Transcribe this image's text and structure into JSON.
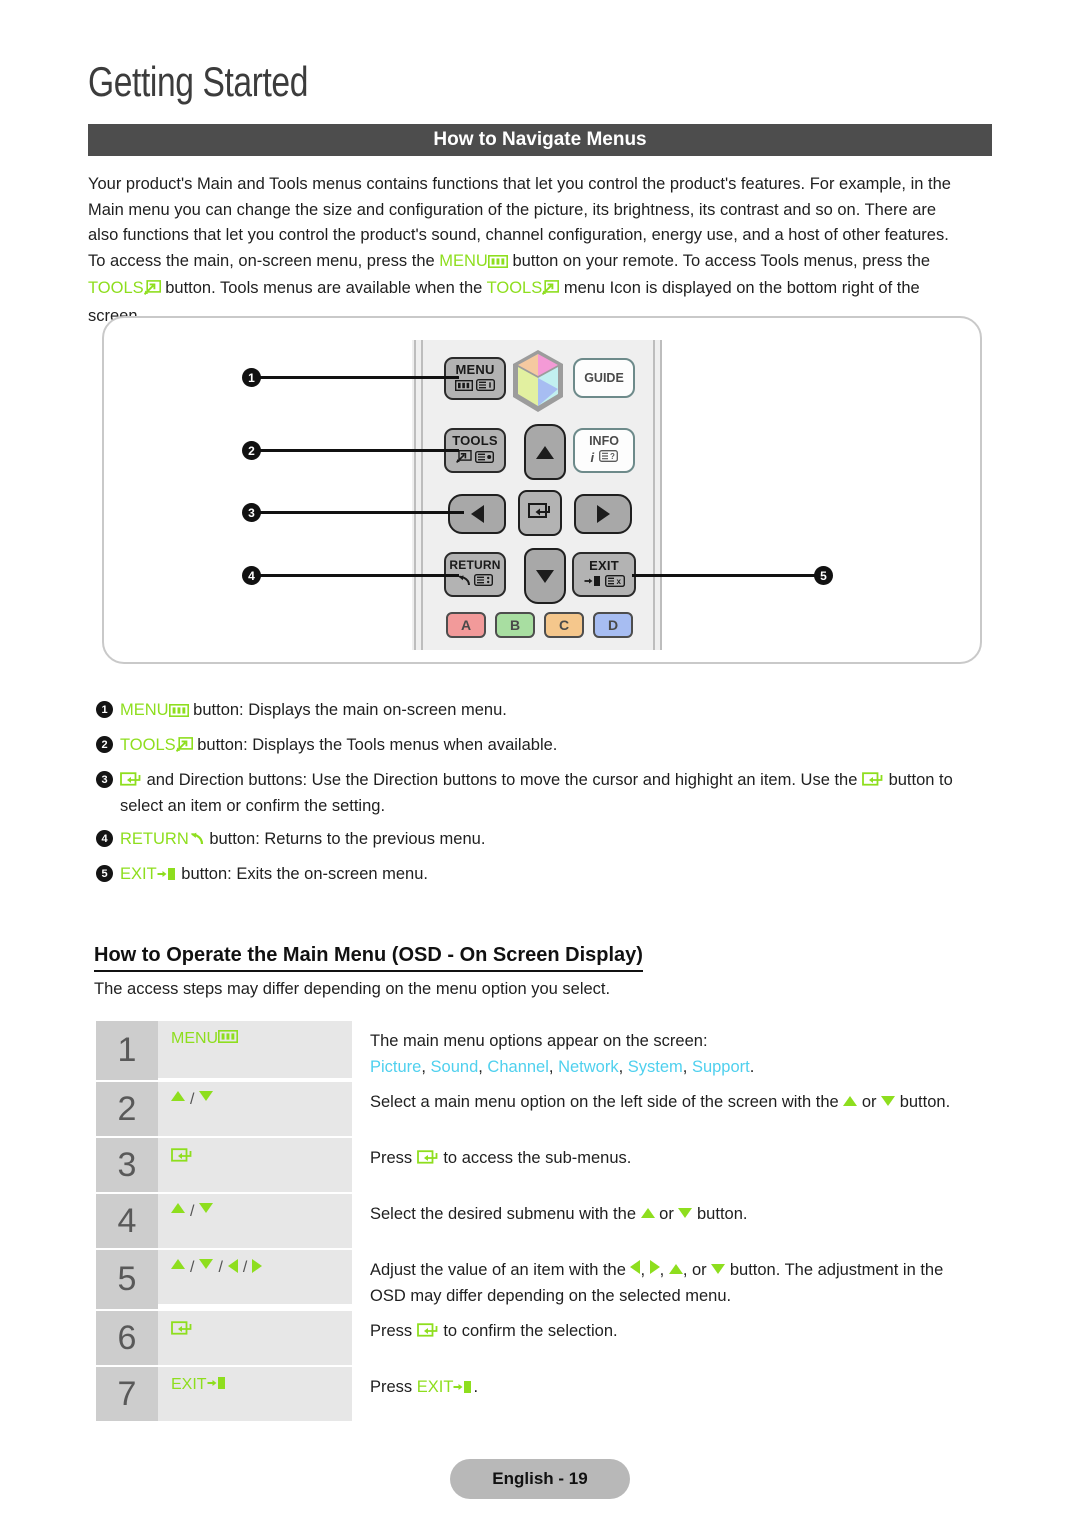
{
  "header": {
    "chapter_title": "Getting Started",
    "section_title": "How to Navigate Menus"
  },
  "intro": {
    "line1_a": "Your product's Main and Tools menus contains functions that let you control the product's features. For example, in the",
    "line2_a": "Main menu you can change the size and configuration of the picture, its brightness, its contrast and so on. There are",
    "line3_a": "also functions that let you control the product's sound, channel configuration, energy use, and a host of other features.",
    "line4_a": "To access the main, on-screen menu, press the ",
    "line4_key": "MENU",
    "line4_b": " button on your remote. To access Tools menus, press the",
    "line5_key": "TOOLS",
    "line5_a": " button. Tools menus are available when the ",
    "line5_key2": "TOOLS",
    "line5_b": " menu Icon is displayed on the bottom right of the",
    "line6": "screen"
  },
  "remote": {
    "buttons": {
      "menu": "MENU",
      "tools": "TOOLS",
      "guide": "GUIDE",
      "info": "INFO",
      "return": "RETURN",
      "exit": "EXIT"
    },
    "color_buttons": [
      {
        "label": "A",
        "color": "#f29a9a"
      },
      {
        "label": "B",
        "color": "#a8dea1"
      },
      {
        "label": "C",
        "color": "#f5c78c"
      },
      {
        "label": "D",
        "color": "#a7bdf2"
      }
    ],
    "cube_colors": {
      "top_left": "#f5c9a0",
      "top_right": "#f49ad6",
      "left": "#e2f0a0",
      "right": "#c2f0f0",
      "bottom_right": "#a9c2f2",
      "edge": "#9c9c9c"
    },
    "callouts": [
      "1",
      "2",
      "3",
      "4",
      "5"
    ]
  },
  "bullets": [
    {
      "num": "1",
      "key": "MENU",
      "icon": "menu-bars-icon",
      "text": " button: Displays the main on-screen menu."
    },
    {
      "num": "2",
      "key": "TOOLS",
      "icon": "tools-arrow-icon",
      "text": " button: Displays the Tools menus when available."
    },
    {
      "num": "3",
      "key": "",
      "icon": "enter-icon",
      "text_a": " and Direction buttons: Use the Direction buttons to move the cursor and highight an item. Use the ",
      "text_b": " button to",
      "text_c": "select an item or confirm the setting."
    },
    {
      "num": "4",
      "key": "RETURN",
      "icon": "return-arrow-icon",
      "text": " button: Returns to the previous menu."
    },
    {
      "num": "5",
      "key": "EXIT",
      "icon": "exit-door-icon",
      "text": " button: Exits the on-screen menu."
    }
  ],
  "osd": {
    "heading": "How to Operate the Main Menu (OSD - On Screen Display)",
    "subtitle": "The access steps may differ depending on the menu option you select.",
    "steps": [
      {
        "num": "1",
        "key_label": "MENU",
        "key_icon": "menu-bars-icon",
        "desc_line1": "The main menu options appear on the screen:",
        "menu_options": [
          "Picture",
          "Sound",
          "Channel",
          "Network",
          "System",
          "Support"
        ],
        "menu_options_suffix": "."
      },
      {
        "num": "2",
        "key_label": "",
        "key_icon": "up-down-arrows",
        "desc_a": "Select a main menu option on the left side of the screen with the ",
        "desc_b": " or ",
        "desc_c": " button."
      },
      {
        "num": "3",
        "key_label": "",
        "key_icon": "enter-icon",
        "desc_a": "Press ",
        "desc_b": " to access the sub-menus."
      },
      {
        "num": "4",
        "key_label": "",
        "key_icon": "up-down-arrows",
        "desc_a": "Select the desired submenu with the ",
        "desc_b": " or ",
        "desc_c": " button."
      },
      {
        "num": "5",
        "key_label": "",
        "key_icon": "four-direction-arrows",
        "desc_a": "Adjust the value of an item with the ",
        "desc_b": ", ",
        "desc_c": ", ",
        "desc_d": ", or ",
        "desc_e": " button. The adjustment in the",
        "desc_line2": "OSD may differ depending on the selected menu."
      },
      {
        "num": "6",
        "key_label": "",
        "key_icon": "enter-icon",
        "desc_a": "Press ",
        "desc_b": " to confirm the selection."
      },
      {
        "num": "7",
        "key_label": "EXIT",
        "key_icon": "exit-door-icon",
        "desc_a": "Press ",
        "desc_b": "EXIT",
        "desc_c": "."
      }
    ]
  },
  "footer": {
    "label": "English - 19"
  },
  "colors": {
    "accent_green": "#8ede1e",
    "menu_option_blue": "#4fd0ee",
    "section_bar": "#4d4d4d",
    "step_num_bg": "#cdcdcd",
    "step_key_bg": "#e7e7e7"
  }
}
